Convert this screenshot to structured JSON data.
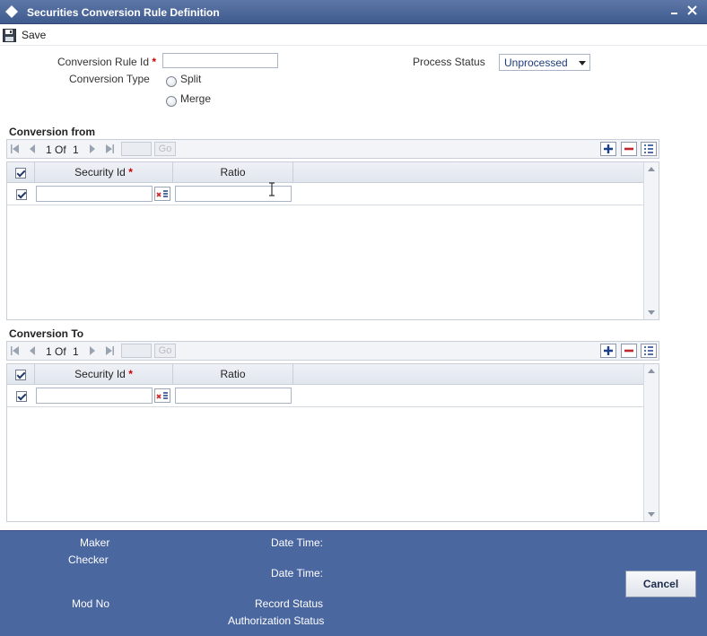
{
  "window": {
    "title": "Securities Conversion Rule Definition",
    "minimize_glyph": "–",
    "close_glyph": "✕"
  },
  "toolbar": {
    "save_label": "Save"
  },
  "form": {
    "conversion_rule_id_label": "Conversion Rule Id",
    "conversion_rule_id_value": "",
    "required_mark": "*",
    "conversion_type_label": "Conversion Type",
    "conversion_type_options": [
      "Split",
      "Merge"
    ],
    "process_status_label": "Process Status",
    "process_status_value": "Unprocessed"
  },
  "sections": [
    {
      "title": "Conversion from",
      "pager": {
        "current": "1",
        "of_label": "Of",
        "total": "1",
        "go_label": "Go"
      },
      "columns": [
        "Security Id",
        "Ratio"
      ],
      "rows": [
        {
          "checked": true,
          "security_id": "",
          "ratio": ""
        }
      ]
    },
    {
      "title": "Conversion To",
      "pager": {
        "current": "1",
        "of_label": "Of",
        "total": "1",
        "go_label": "Go"
      },
      "columns": [
        "Security Id",
        "Ratio"
      ],
      "rows": [
        {
          "checked": true,
          "security_id": "",
          "ratio": ""
        }
      ]
    }
  ],
  "footer": {
    "maker_label": "Maker",
    "checker_label": "Checker",
    "date_time_label": "Date Time:",
    "mod_no_label": "Mod No",
    "record_status_label": "Record Status",
    "authorization_status_label": "Authorization Status",
    "cancel_label": "Cancel"
  },
  "colors": {
    "title_bar": "#4a67a0",
    "footer": "#4a67a0",
    "required": "#cc0000",
    "select_text": "#1d3c7a"
  }
}
